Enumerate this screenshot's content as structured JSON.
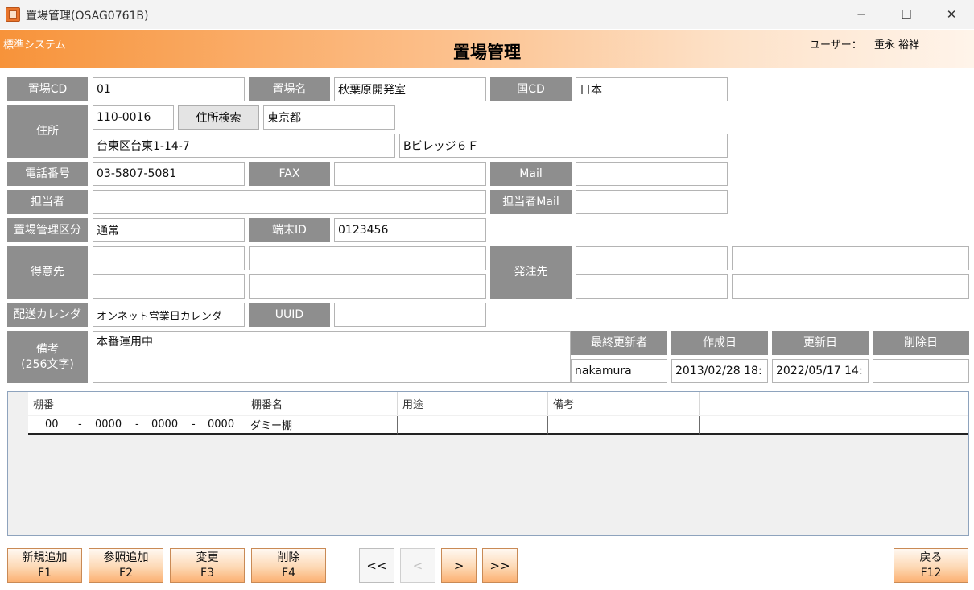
{
  "window": {
    "title": "置場管理(OSAG0761B)",
    "minimize": "─",
    "maximize": "☐",
    "close": "✕"
  },
  "header": {
    "system": "標準システム",
    "title": "置場管理",
    "user_label": "ユーザー：",
    "user_name": "重永 裕祥"
  },
  "form": {
    "place_cd": {
      "label": "置場CD",
      "value": "01"
    },
    "place_name": {
      "label": "置場名",
      "value": "秋葉原開発室"
    },
    "country_cd": {
      "label": "国CD",
      "value": "日本"
    },
    "address": {
      "label": "住所",
      "zip": "110-0016",
      "search_button": "住所検索",
      "pref": "東京都",
      "line1": "台東区台東1-14-7",
      "line2": "Bビレッジ６Ｆ"
    },
    "phone": {
      "label": "電話番号",
      "value": "03-5807-5081"
    },
    "fax": {
      "label": "FAX",
      "value": ""
    },
    "mail": {
      "label": "Mail",
      "value": ""
    },
    "person": {
      "label": "担当者",
      "value": ""
    },
    "person_mail": {
      "label": "担当者Mail",
      "value": ""
    },
    "place_type": {
      "label": "置場管理区分",
      "value": "通常"
    },
    "terminal_id": {
      "label": "端末ID",
      "value": "0123456"
    },
    "customer": {
      "label": "得意先",
      "values": [
        "",
        "",
        "",
        ""
      ]
    },
    "supplier": {
      "label": "発注先",
      "values": [
        "",
        "",
        "",
        ""
      ]
    },
    "calendar": {
      "label": "配送カレンダ",
      "value": "オンネット営業日カレンダ"
    },
    "uuid": {
      "label": "UUID",
      "value": ""
    },
    "remarks": {
      "label1": "備考",
      "label2": "(256文字)",
      "value": "本番運用中"
    },
    "last_updater": {
      "label": "最終更新者",
      "value": "nakamura"
    },
    "created": {
      "label": "作成日",
      "value": "2013/02/28 18:"
    },
    "updated": {
      "label": "更新日",
      "value": "2022/05/17 14:"
    },
    "deleted": {
      "label": "削除日",
      "value": ""
    }
  },
  "grid": {
    "columns": [
      "棚番",
      "棚番名",
      "用途",
      "備考"
    ],
    "rows": [
      {
        "shelf_parts": [
          "00",
          "-",
          "0000",
          "-",
          "0000",
          "-",
          "0000"
        ],
        "name": "ダミー棚",
        "use": "",
        "note": ""
      }
    ]
  },
  "buttons": {
    "new": {
      "label": "新規追加",
      "key": "F1"
    },
    "ref_add": {
      "label": "参照追加",
      "key": "F2"
    },
    "change": {
      "label": "変更",
      "key": "F3"
    },
    "delete": {
      "label": "削除",
      "key": "F4"
    },
    "first": "<<",
    "prev": "<",
    "next": ">",
    "last": ">>",
    "back": {
      "label": "戻る",
      "key": "F12"
    }
  }
}
